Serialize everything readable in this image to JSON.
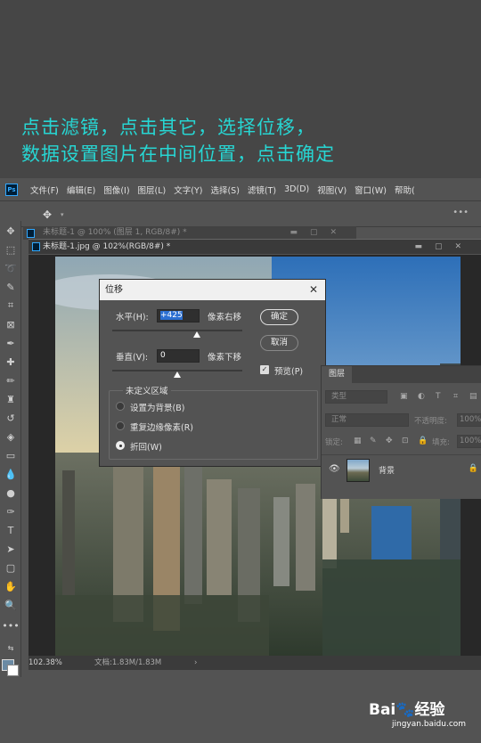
{
  "caption": {
    "line1": "点击滤镜，点击其它，选择位移，",
    "line2": "数据设置图片在中间位置，点击确定"
  },
  "menubar": {
    "logo": "Ps",
    "items": [
      "文件(F)",
      "编辑(E)",
      "图像(I)",
      "图层(L)",
      "文字(Y)",
      "选择(S)",
      "滤镜(T)",
      "3D(D)",
      "视图(V)",
      "窗口(W)",
      "帮助("
    ]
  },
  "tabs": {
    "inactive": "未标题-1 @ 100% (图层 1, RGB/8#) *",
    "active": "未标题-1.jpg @ 102%(RGB/8#) *"
  },
  "status": {
    "zoom": "102.38%",
    "doc": "文档:1.83M/1.83M",
    "arrow": "›"
  },
  "dialog": {
    "title": "位移",
    "close": "✕",
    "horizontal_label": "水平(H):",
    "horizontal_value": "+425",
    "horizontal_unit": "像素右移",
    "horizontal_slider": 0.65,
    "vertical_label": "垂直(V):",
    "vertical_value": "0",
    "vertical_unit": "像素下移",
    "vertical_slider": 0.5,
    "ok": "确定",
    "cancel": "取消",
    "preview": "预览(P)",
    "preview_checked": true,
    "undefined_area": "未定义区域",
    "options": [
      "设置为背景(B)",
      "重复边缘像素(R)",
      "折回(W)"
    ],
    "selected_option": 2
  },
  "layers": {
    "tab": "图层",
    "kind": "类型",
    "blend": "正常",
    "opacity_label": "不透明度:",
    "opacity": "100%",
    "lock_label": "锁定:",
    "fill_label": "填充:",
    "fill": "100%",
    "layer_name": "背景"
  },
  "watermark": {
    "brand_a": "Bai",
    "brand_paw": "🐾",
    "brand_b": "经验",
    "url": "jingyan.baidu.com"
  }
}
